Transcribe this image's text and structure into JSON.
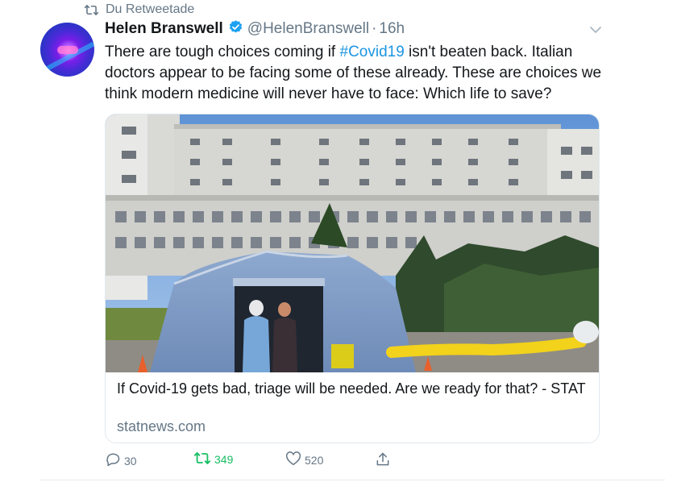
{
  "retweet_notice": {
    "text": "Du Retweetade",
    "icon": "retweet-icon"
  },
  "tweet": {
    "author_name": "Helen Branswell",
    "verified": true,
    "handle": "@HelenBranswell",
    "separator": "·",
    "time": "16h",
    "text_before": "There are tough choices coming if ",
    "hashtag": "#Covid19",
    "text_after": " isn't beaten back. Italian doctors appear to be facing some of these already. These are choices we think modern medicine will never have to face: Which life to save?"
  },
  "card": {
    "title": "If Covid-19 gets bad, triage will be needed. Are we ready for that? - STAT",
    "domain": "statnews.com"
  },
  "actions": {
    "replies": "30",
    "retweets": "349",
    "likes": "520"
  },
  "colors": {
    "link_blue": "#1b95e0",
    "secondary_gray": "#657786",
    "retweet_green": "#17bf63",
    "border": "#e1e8ed"
  }
}
